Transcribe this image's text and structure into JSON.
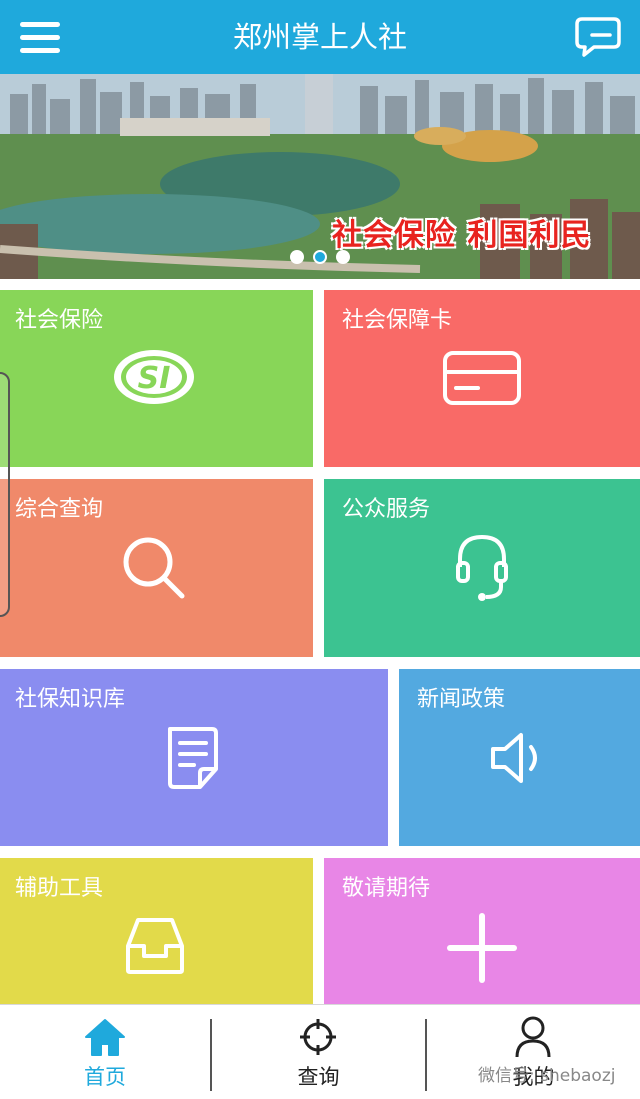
{
  "header": {
    "title": "郑州掌上人社",
    "menu_icon": "menu-icon",
    "message_icon": "message-icon"
  },
  "banner": {
    "slogan": "社会保险  利国利民",
    "slide_count": 3,
    "active_slide": 2
  },
  "tiles": [
    {
      "label": "社会保险",
      "color": "#88d658",
      "icon": "si-logo-icon"
    },
    {
      "label": "社会保障卡",
      "color": "#f96a67",
      "icon": "card-icon"
    },
    {
      "label": "综合查询",
      "color": "#f0896a",
      "icon": "search-icon"
    },
    {
      "label": "公众服务",
      "color": "#3cc391",
      "icon": "headset-icon"
    },
    {
      "label": "社保知识库",
      "color": "#8a8df0",
      "icon": "document-icon"
    },
    {
      "label": "新闻政策",
      "color": "#53a9e0",
      "icon": "speaker-icon"
    },
    {
      "label": "辅助工具",
      "color": "#e2da4a",
      "icon": "inbox-icon"
    },
    {
      "label": "敬请期待",
      "color": "#e886e6",
      "icon": "plus-icon"
    }
  ],
  "tabbar": {
    "items": [
      {
        "label": "首页",
        "icon": "home-icon",
        "active": true
      },
      {
        "label": "查询",
        "icon": "crosshair-icon",
        "active": false
      },
      {
        "label": "我的",
        "icon": "user-icon",
        "active": false
      }
    ]
  },
  "watermark": "微信号: shebaozj",
  "colors": {
    "primary": "#1fa9dc"
  }
}
